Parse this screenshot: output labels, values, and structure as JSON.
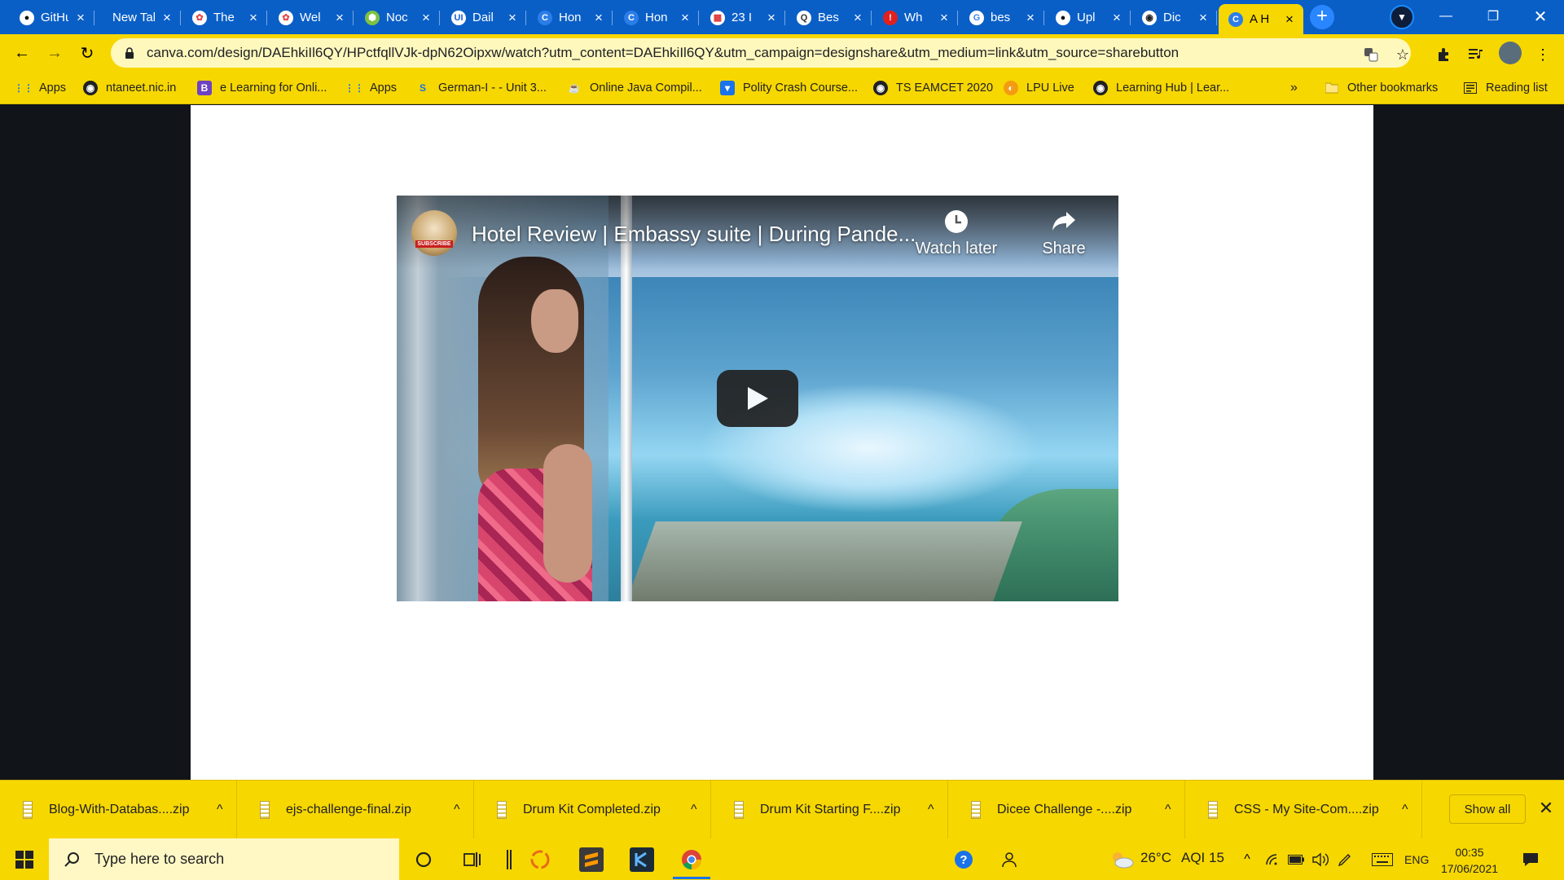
{
  "tabs": [
    {
      "label": "GitHub",
      "favicon": "github-icon",
      "active": false
    },
    {
      "label": "New Tab",
      "favicon": "",
      "active": false
    },
    {
      "label": "The",
      "favicon": "brand-icon",
      "active": false
    },
    {
      "label": "Wel",
      "favicon": "brand-icon",
      "active": false
    },
    {
      "label": "Noc",
      "favicon": "nodejs-icon",
      "active": false
    },
    {
      "label": "Dail",
      "favicon": "ui-icon",
      "active": false
    },
    {
      "label": "Hon",
      "favicon": "canva-icon",
      "active": false
    },
    {
      "label": "Hon",
      "favicon": "canva-icon",
      "active": false
    },
    {
      "label": "23 I",
      "favicon": "calendar-icon",
      "active": false
    },
    {
      "label": "Bes",
      "favicon": "search-icon",
      "active": false
    },
    {
      "label": "Wh",
      "favicon": "alert-icon",
      "active": false
    },
    {
      "label": "bes",
      "favicon": "google-icon",
      "active": false
    },
    {
      "label": "Upl",
      "favicon": "github-icon",
      "active": false
    },
    {
      "label": "Dic",
      "favicon": "globe-icon",
      "active": false
    },
    {
      "label": "A H",
      "favicon": "canva-icon",
      "active": true
    }
  ],
  "toolbar": {
    "url": "canva.com/design/DAEhkiIl6QY/HPctfqllVJk-dpN62Oipxw/watch?utm_content=DAEhkiIl6QY&utm_campaign=designshare&utm_medium=link&utm_source=sharebutton"
  },
  "bookmarks": [
    {
      "label": "Apps",
      "icon": "apps-grid-icon"
    },
    {
      "label": "ntaneet.nic.in",
      "icon": "globe-icon"
    },
    {
      "label": "e Learning for Onli...",
      "icon": "bootstrap-icon"
    },
    {
      "label": "Apps",
      "icon": "apps-grid-icon"
    },
    {
      "label": "German-I - - Unit 3...",
      "icon": "s-icon"
    },
    {
      "label": "Online Java Compil...",
      "icon": "java-icon"
    },
    {
      "label": "Polity Crash Course...",
      "icon": "cup-icon"
    },
    {
      "label": "TS EAMCET 2020",
      "icon": "globe-icon"
    },
    {
      "label": "LPU Live",
      "icon": "lpu-icon"
    },
    {
      "label": "Learning Hub | Lear...",
      "icon": "globe-icon"
    }
  ],
  "bookmarks_more": "»",
  "other_bookmarks": "Other bookmarks",
  "reading_list": "Reading list",
  "video": {
    "title": "Hotel Review | Embassy suite | During Pande...",
    "watch_later": "Watch later",
    "share": "Share",
    "avatar_badge": "SUBSCRIBE"
  },
  "downloads": [
    "Blog-With-Databas....zip",
    "ejs-challenge-final.zip",
    "Drum Kit Completed.zip",
    "Drum Kit Starting F....zip",
    "Dicee Challenge -....zip",
    "CSS - My Site-Com....zip"
  ],
  "downloads_show_all": "Show all",
  "taskbar": {
    "search_placeholder": "Type here to search",
    "weather": "26°C",
    "aqi": "AQI 15",
    "language": "ENG",
    "time": "00:35",
    "date": "17/06/2021"
  },
  "colors": {
    "tabstrip": "#0a5fc7",
    "theme_yellow": "#f7d700",
    "page_background": "#111519"
  }
}
